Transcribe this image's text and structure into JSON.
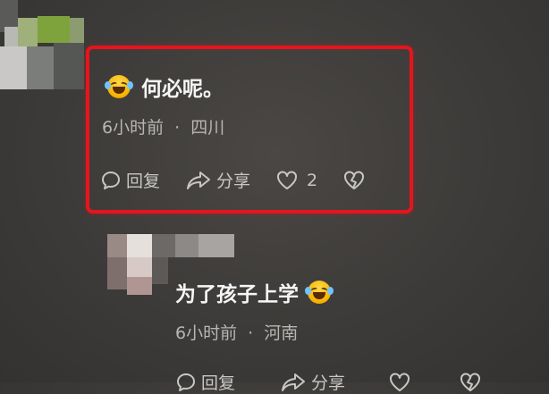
{
  "comments": [
    {
      "text": "何必呢。",
      "time": "6小时前",
      "location": "四川",
      "reply_label": "回复",
      "share_label": "分享",
      "like_count": "2"
    },
    {
      "text": "为了孩子上学",
      "time": "6小时前",
      "location": "河南",
      "reply_label": "回复",
      "share_label": "分享"
    }
  ],
  "separator": "·",
  "icons": {
    "emoji": "laughing-crying-emoji",
    "reply": "speech-bubble-icon",
    "share": "share-arrow-icon",
    "like": "heart-icon",
    "dislike": "broken-heart-icon"
  },
  "colors": {
    "highlight": "#e8141c",
    "background": "#3d3b39"
  }
}
